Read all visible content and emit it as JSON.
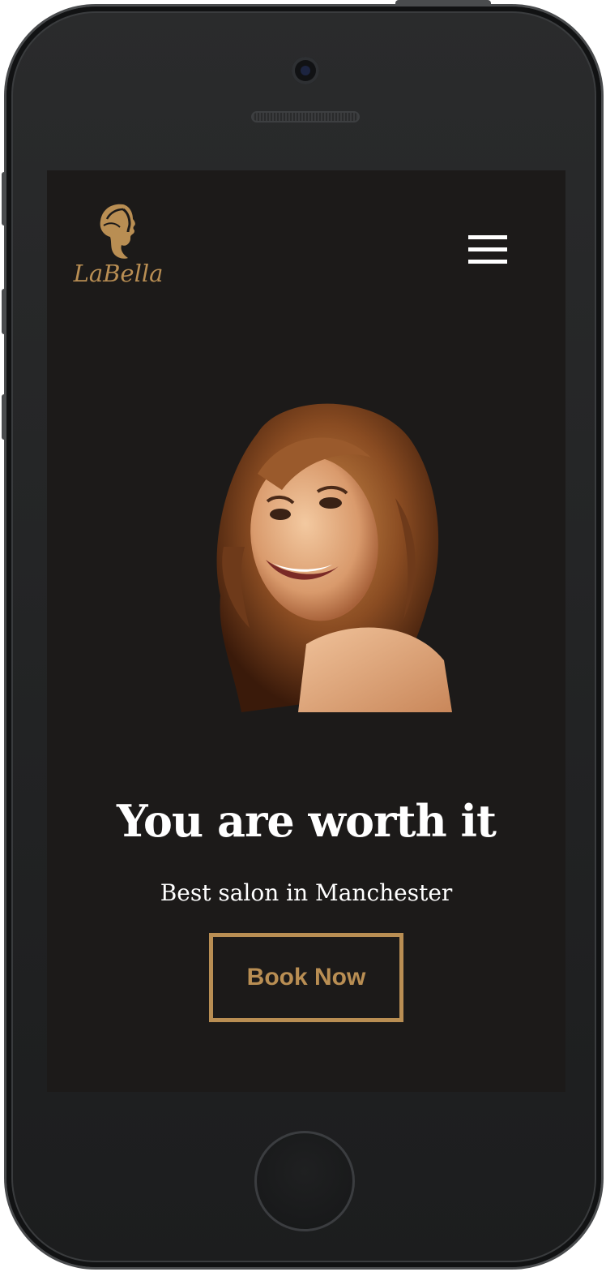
{
  "brand": {
    "name": "LaBella",
    "accent_color": "#b98e53"
  },
  "header": {
    "menu_icon": "hamburger-menu-icon"
  },
  "hero": {
    "image": "smiling-woman-curly-hair-photo",
    "headline": "You are worth it",
    "subheadline": "Best salon in Manchester",
    "cta_label": "Book Now"
  },
  "colors": {
    "screen_background": "#1c1a19",
    "text": "#ffffff"
  }
}
